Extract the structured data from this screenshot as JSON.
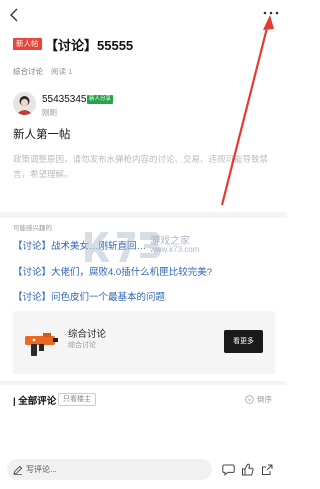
{
  "post": {
    "badge": "新人帖",
    "title": "【讨论】55555",
    "category": "综合讨论",
    "reads": "阅读 1",
    "author": "55435345",
    "author_badge": "新人分享",
    "time": "刚刚",
    "body": "新人第一帖",
    "notice": "政策调整原因，请勿发布水弹枪内容的讨论、交易、违规可能导致禁言，希望理解。"
  },
  "recommend": {
    "title": "可能感兴趣的",
    "items": [
      {
        "label": "【讨论】战术美女…刚斩直回…"
      },
      {
        "label": "【讨论】大佬们，腐败4.0插什么机匣比较完美?"
      },
      {
        "label": "【讨论】问色皮们一个最基本的问题"
      }
    ]
  },
  "forum_card": {
    "title": "综合讨论",
    "subtitle": "综合讨论",
    "button": "看更多"
  },
  "comments": {
    "title": "| 全部评论",
    "filter": "只看楼主",
    "sort": "倒序"
  },
  "bottom": {
    "placeholder": "写评论..."
  },
  "watermark": {
    "text": "游戏之家",
    "url": "www.k73.com"
  },
  "colors": {
    "accent_red": "#e8443a",
    "link_blue": "#2f64b8",
    "badge_green": "#27a34b"
  }
}
